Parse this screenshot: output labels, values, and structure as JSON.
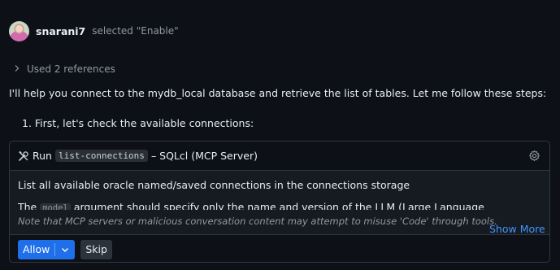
{
  "user": {
    "name": "snarani7",
    "action": "selected \"Enable\""
  },
  "references": {
    "label": "Used 2 references"
  },
  "message": {
    "intro": "I'll help you connect to the mydb_local database and retrieve the list of tables. Let me follow these steps:",
    "step1": "1. First, let's check the available connections:"
  },
  "tool": {
    "run_label": "Run",
    "command": "list-connections",
    "server": "– SQLcl (MCP Server)",
    "description": "List all available oracle named/saved connections in the connections storage",
    "param_prefix": "The",
    "param_code": "model",
    "param_rest": "argument should specify only the name and version of the LLM (Large Language Model)",
    "show_more": "Show More",
    "warning": "Note that MCP servers or malicious conversation content may attempt to misuse 'Code' through tools."
  },
  "actions": {
    "allow": "Allow",
    "skip": "Skip"
  },
  "colors": {
    "accent": "#1f6feb",
    "link": "#4493f8",
    "background": "#0d1117"
  }
}
